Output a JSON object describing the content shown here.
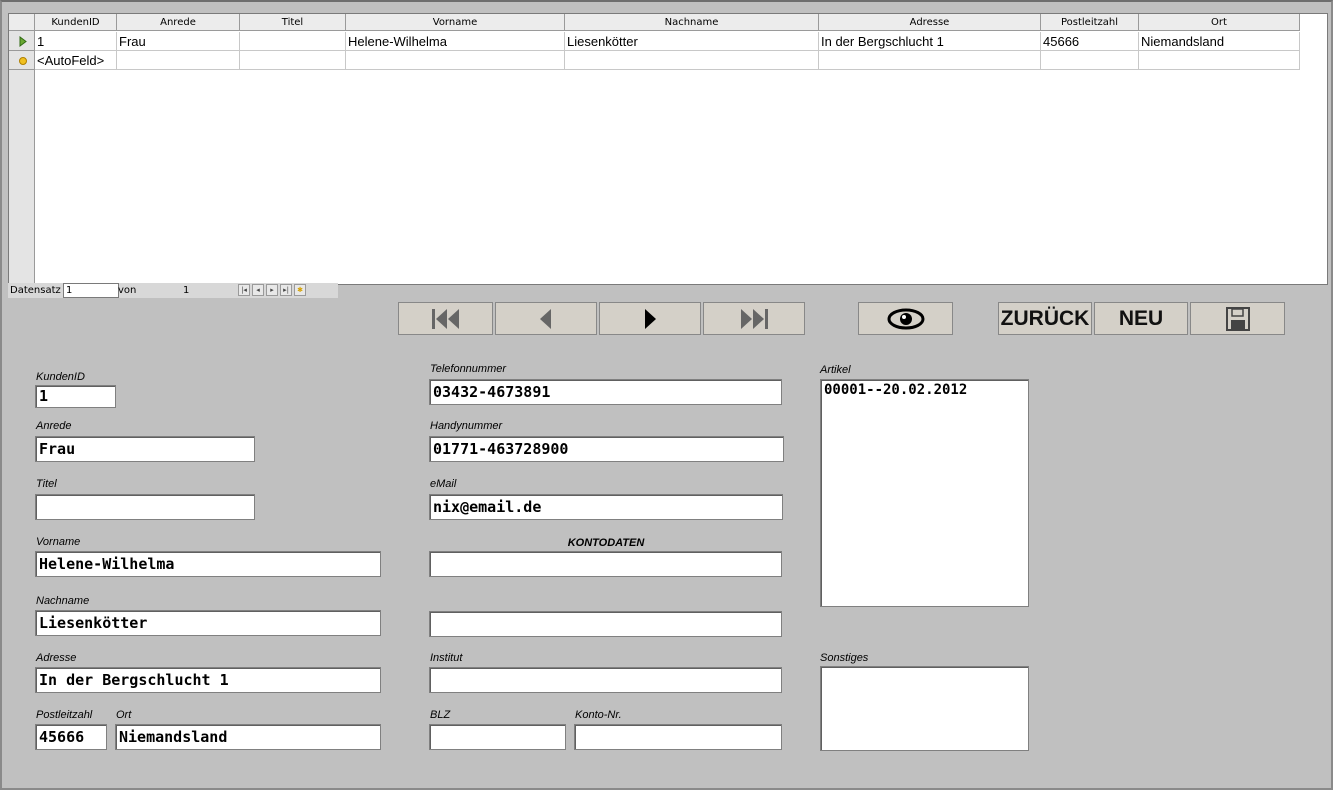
{
  "grid": {
    "columns": [
      "KundenID",
      "Anrede",
      "Titel",
      "Vorname",
      "Nachname",
      "Adresse",
      "Postleitzahl",
      "Ort"
    ],
    "rows": [
      [
        "1",
        "Frau",
        "",
        "Helene-Wilhelma",
        "Liesenkötter",
        "In der Bergschlucht 1",
        "45666",
        "Niemandsland"
      ],
      [
        "<AutoFeld>",
        "",
        "",
        "",
        "",
        "",
        "",
        ""
      ]
    ],
    "nav": {
      "record_label": "Datensatz",
      "record_value": "1",
      "of_label": "von",
      "total": "1"
    }
  },
  "toolbar": {
    "first_icon": "first-record-icon",
    "prev_icon": "previous-record-icon",
    "next_icon": "next-record-icon",
    "last_icon": "last-record-icon",
    "view_icon": "eye-icon",
    "back_label": "ZURÜCK",
    "new_label": "NEU",
    "save_icon": "save-disk-icon"
  },
  "form": {
    "kundenid": {
      "label": "KundenID",
      "value": "1"
    },
    "anrede": {
      "label": "Anrede",
      "value": "Frau"
    },
    "titel": {
      "label": "Titel",
      "value": ""
    },
    "vorname": {
      "label": "Vorname",
      "value": "Helene-Wilhelma"
    },
    "nachname": {
      "label": "Nachname",
      "value": "Liesenkötter"
    },
    "adresse": {
      "label": "Adresse",
      "value": "In der Bergschlucht 1"
    },
    "plz": {
      "label": "Postleitzahl",
      "value": "45666"
    },
    "ort": {
      "label": "Ort",
      "value": "Niemandsland"
    },
    "telefon": {
      "label": "Telefonnummer",
      "value": "03432-4673891"
    },
    "handy": {
      "label": "Handynummer",
      "value": "01771-463728900"
    },
    "email": {
      "label": "eMail",
      "value": "nix@email.de"
    },
    "kontodaten_heading": "KONTODATEN",
    "konto1": {
      "value": ""
    },
    "konto2": {
      "value": ""
    },
    "institut": {
      "label": "Institut",
      "value": ""
    },
    "blz": {
      "label": "BLZ",
      "value": ""
    },
    "kontonr": {
      "label": "Konto-Nr.",
      "value": ""
    },
    "artikel": {
      "label": "Artikel",
      "value": "00001--20.02.2012"
    },
    "sonstiges": {
      "label": "Sonstiges",
      "value": ""
    }
  },
  "colors": {
    "background": "#c0c0c0",
    "grid_header": "#ececec",
    "field": "#ffffff"
  }
}
